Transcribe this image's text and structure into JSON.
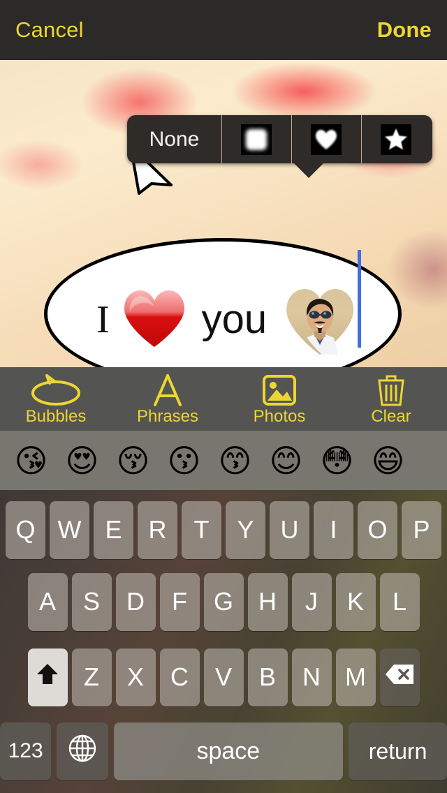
{
  "topbar": {
    "cancel_label": "Cancel",
    "done_label": "Done",
    "background_color": "#2b2a28",
    "text_color": "#eed634"
  },
  "mask_popup": {
    "none_label": "None",
    "options": [
      {
        "name": "none",
        "label": "None",
        "icon": "none-text"
      },
      {
        "name": "rounded-square",
        "label": "",
        "icon": "rounded-square-mask-icon"
      },
      {
        "name": "heart",
        "label": "",
        "icon": "heart-mask-icon"
      },
      {
        "name": "star",
        "label": "",
        "icon": "star-mask-icon"
      }
    ],
    "background_color": "#2f2b29",
    "divider_color": "#c8a99a"
  },
  "bubble": {
    "text_before": "I",
    "emoji": "heart",
    "text_after": "you",
    "photo_mask": "heart",
    "cursor_color": "#3f6fe0",
    "fill_color": "#ffffff",
    "outline_color": "#000000"
  },
  "toolbar": {
    "background_color": "#545452",
    "accent_color": "#ecd633",
    "items": [
      {
        "label": "Bubbles",
        "icon": "speech-bubble-icon"
      },
      {
        "label": "Phrases",
        "icon": "letter-a-icon"
      },
      {
        "label": "Photos",
        "icon": "photo-icon"
      },
      {
        "label": "Clear",
        "icon": "trash-icon"
      }
    ]
  },
  "emoji_strip": {
    "background_color": "#77766f",
    "emojis": [
      {
        "name": "face-blowing-a-kiss",
        "glyph": "😘"
      },
      {
        "name": "smiling-face-with-heart-eyes",
        "glyph": "😍"
      },
      {
        "name": "kissing-face-with-closed-eyes",
        "glyph": "😚"
      },
      {
        "name": "kissing-face",
        "glyph": "😗"
      },
      {
        "name": "kissing-face-with-smiling-eyes",
        "glyph": "😙"
      },
      {
        "name": "smiling-face-with-smiling-eyes",
        "glyph": "😊"
      },
      {
        "name": "flushed-face",
        "glyph": "😳"
      },
      {
        "name": "grinning-face-with-smiling-eyes",
        "glyph": "😄"
      }
    ]
  },
  "keyboard": {
    "row1": [
      "Q",
      "W",
      "E",
      "R",
      "T",
      "Y",
      "U",
      "I",
      "O",
      "P"
    ],
    "row2": [
      "A",
      "S",
      "D",
      "F",
      "G",
      "H",
      "J",
      "K",
      "L"
    ],
    "row3": [
      "Z",
      "X",
      "C",
      "V",
      "B",
      "N",
      "M"
    ],
    "shift_icon": "shift-arrow-icon",
    "backspace_icon": "backspace-icon",
    "numbers_label": "123",
    "globe_icon": "globe-icon",
    "space_label": "space",
    "return_label": "return",
    "shift_active": true
  }
}
